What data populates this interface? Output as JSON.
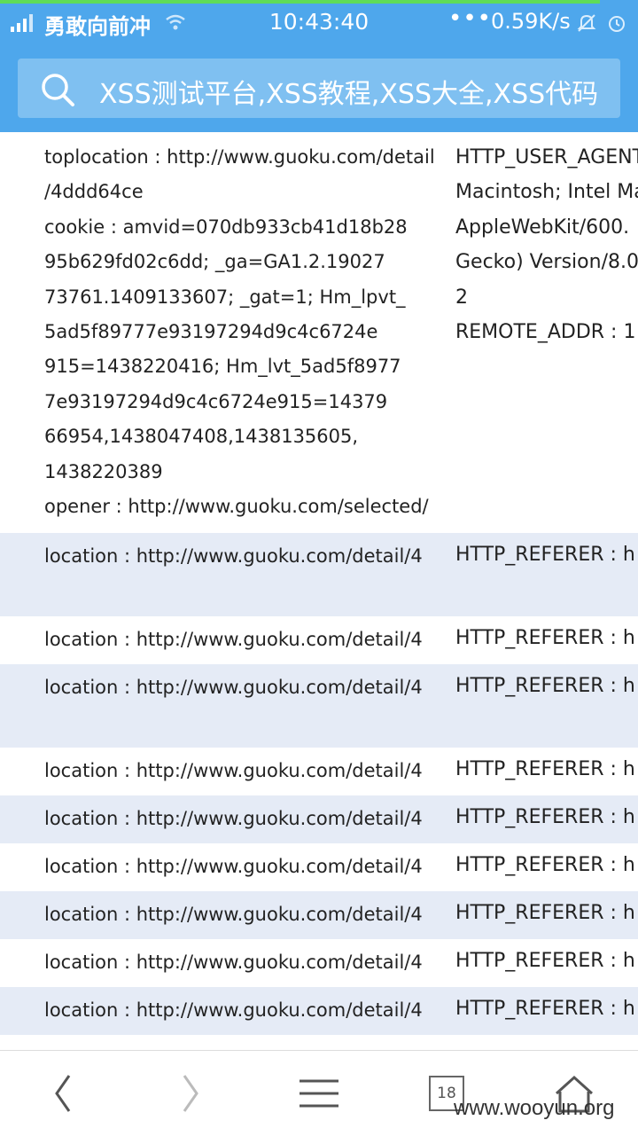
{
  "status": {
    "carrier": "勇敢向前冲",
    "time": "10:43:40",
    "more": "•••",
    "speed": "0.59K/s",
    "progress_fraction": 0.94
  },
  "search": {
    "text": "XSS测试平台,XSS教程,XSS大全,XSS代码"
  },
  "first_row": {
    "top_right_cut": ")",
    "left_lines": [
      "toplocation : http://www.guoku.com/detail",
      "/4ddd64ce",
      "cookie : amvid=070db933cb41d18b28",
      "95b629fd02c6dd; _ga=GA1.2.19027",
      "73761.1409133607; _gat=1; Hm_lpvt_",
      "5ad5f89777e93197294d9c4c6724e",
      "915=1438220416; Hm_lvt_5ad5f8977",
      "7e93197294d9c4c6724e915=14379",
      "66954,1438047408,1438135605,",
      "1438220389",
      "opener : http://www.guoku.com/selected/"
    ],
    "right_lines": [
      "HTTP_USER_AGENT",
      "Macintosh; Intel Mac",
      "AppleWebKit/600.",
      "Gecko) Version/8.0.",
      "2",
      "REMOTE_ADDR : 1"
    ]
  },
  "rows": [
    {
      "loc": "location : http://www.guoku.com/detail/4",
      "ref": "HTTP_REFERER : h",
      "style": "blue"
    },
    {
      "loc": "location : http://www.guoku.com/detail/4",
      "ref": "HTTP_REFERER : h",
      "style": "white"
    },
    {
      "loc": "location : http://www.guoku.com/detail/4",
      "ref": "HTTP_REFERER : h",
      "style": "blue"
    },
    {
      "loc": "location : http://www.guoku.com/detail/4",
      "ref": "HTTP_REFERER : h",
      "style": "white"
    },
    {
      "loc": "location : http://www.guoku.com/detail/4",
      "ref": "HTTP_REFERER : h",
      "style": "blue"
    },
    {
      "loc": "location : http://www.guoku.com/detail/4",
      "ref": "HTTP_REFERER : h",
      "style": "white"
    },
    {
      "loc": "location : http://www.guoku.com/detail/4",
      "ref": "HTTP_REFERER : h",
      "style": "blue"
    },
    {
      "loc": "location : http://www.guoku.com/detail/4",
      "ref": "HTTP_REFERER : h",
      "style": "white"
    },
    {
      "loc": "location : http://www.guoku.com/detail/4",
      "ref": "HTTP_REFERER : h",
      "style": "blue"
    }
  ],
  "nav": {
    "tab_count": "18",
    "icons": [
      "back-icon",
      "forward-icon",
      "menu-icon",
      "tabs-icon",
      "home-icon"
    ]
  },
  "watermark": "www.wooyun.org",
  "colors": {
    "header": "#4ea7ec",
    "search_field": "#7fc0f1",
    "row_alt": "#e5ebf6",
    "progress": "#5fdc58"
  }
}
